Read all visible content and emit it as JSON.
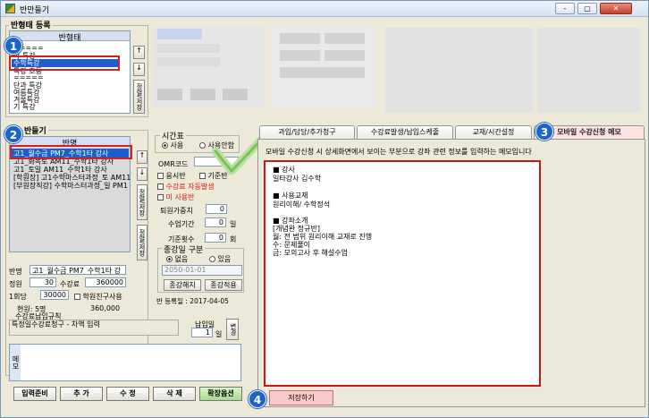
{
  "window": {
    "title": "반만들기",
    "controls": [
      "-",
      "▢",
      "✕"
    ]
  },
  "class_register": {
    "group_label": "반형태 등록",
    "list_header": "반형태",
    "items": [
      "=====",
      "학 특강",
      "수학특강",
      "특강 초등",
      "=====",
      "단과 특강",
      "여름특강",
      "겨울특강",
      "기 특강"
    ],
    "side_label": "정렬/저장"
  },
  "class_list": {
    "group_label": "반들기",
    "list_header": "반명",
    "items": [
      "고1_월수금 PM7_수학1타 강사",
      "고1_화목토 AM11_수학1타 강사",
      "고1_토일 AM11_수학1타 강사",
      "[학원장] 고1수학마스터과정_토 AM11",
      "[부원장직강] 수학마스터과정_일 PM1"
    ],
    "side_labels": [
      "정렬/저장",
      "정렬/저장"
    ]
  },
  "timetable": {
    "label": "시간표",
    "options": [
      "사용",
      "사용안함"
    ],
    "selected": "사용",
    "omr_label": "OMR코드",
    "checks": [
      "응시반",
      "기준반",
      "수강료 자동발생",
      "미 사용반"
    ],
    "refund_label": "퇴원가중치",
    "refund_value": "0",
    "period_label": "수업기간",
    "period_value": "0",
    "period_unit": "일",
    "count_label": "기준횟수",
    "count_value": "0",
    "count_unit": "회",
    "end_group": "종강일 구분",
    "end_options": [
      "없음",
      "있음"
    ],
    "end_date": "2050-01-01",
    "end_btn": "종강해지",
    "apply_btn": "종강적용",
    "reg_date": "반 등록일 : 2017-04-05"
  },
  "class_detail": {
    "name_label": "반명",
    "name_value": "고1_월수금 PM7_수학1타 강",
    "cap_label": "정원",
    "cap_value": "30",
    "fee_label": "수강료",
    "fee_value": "360000",
    "per_label": "1회당",
    "per_value": "30000",
    "friend_label": "학원친구사용",
    "current_label": "현원: 5명",
    "current_fee": "360,000",
    "rule_label": "수강료납입규칙",
    "rule_value": "특정일수강료청구 - 차액 입력",
    "pay_label": "납입일",
    "pay_value": "1",
    "pay_unit": "일",
    "change_btn": "변경",
    "memo_label": "메모"
  },
  "bottom_buttons": [
    "입력준비",
    "추 가",
    "수 정",
    "삭 제",
    "확장옵션"
  ],
  "tabs": [
    "과입/담당/추가청구",
    "수강료발생/납입스케줄",
    "교재/시간설정",
    "모바일 수강신청 메모"
  ],
  "memo": {
    "instruction": "모바일 수강신청 시 상세화면에서 보이는 부분으로 강좌 관련 정보를 입력하는 메모입니다",
    "lines": [
      "■ 강사",
      "  일타강사 김수학",
      "",
      "■ 사용교재",
      "  원리이해/ 수학정석",
      "",
      "■ 강좌소개",
      "  [개념완 정규반]",
      "  월: 전 범위 원리이해 교재로 진행",
      "  수: 문제풀이",
      "  금: 모의고사 후 해설수업"
    ],
    "save_btn": "저장하기"
  },
  "badges": [
    "1",
    "2",
    "3",
    "4"
  ]
}
